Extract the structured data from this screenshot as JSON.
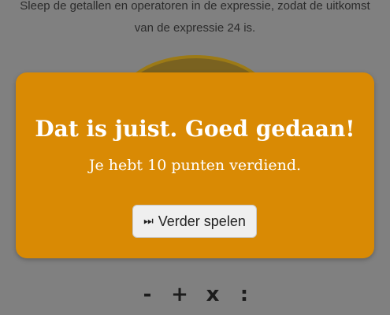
{
  "instructions": {
    "line1": "Sleep de getallen en operatoren in de expressie, zodat de uitkomst",
    "line2": "van de expressie 24 is."
  },
  "modal": {
    "title": "Dat is juist. Goed gedaan!",
    "subtitle": "Je hebt 10 punten verdiend.",
    "button_icon": "⏭",
    "button_label": "Verder spelen"
  },
  "operators": [
    "-",
    "+",
    "x",
    ":"
  ],
  "colors": {
    "background": "#808080",
    "modal": "#d98a04",
    "button": "#efefef"
  }
}
